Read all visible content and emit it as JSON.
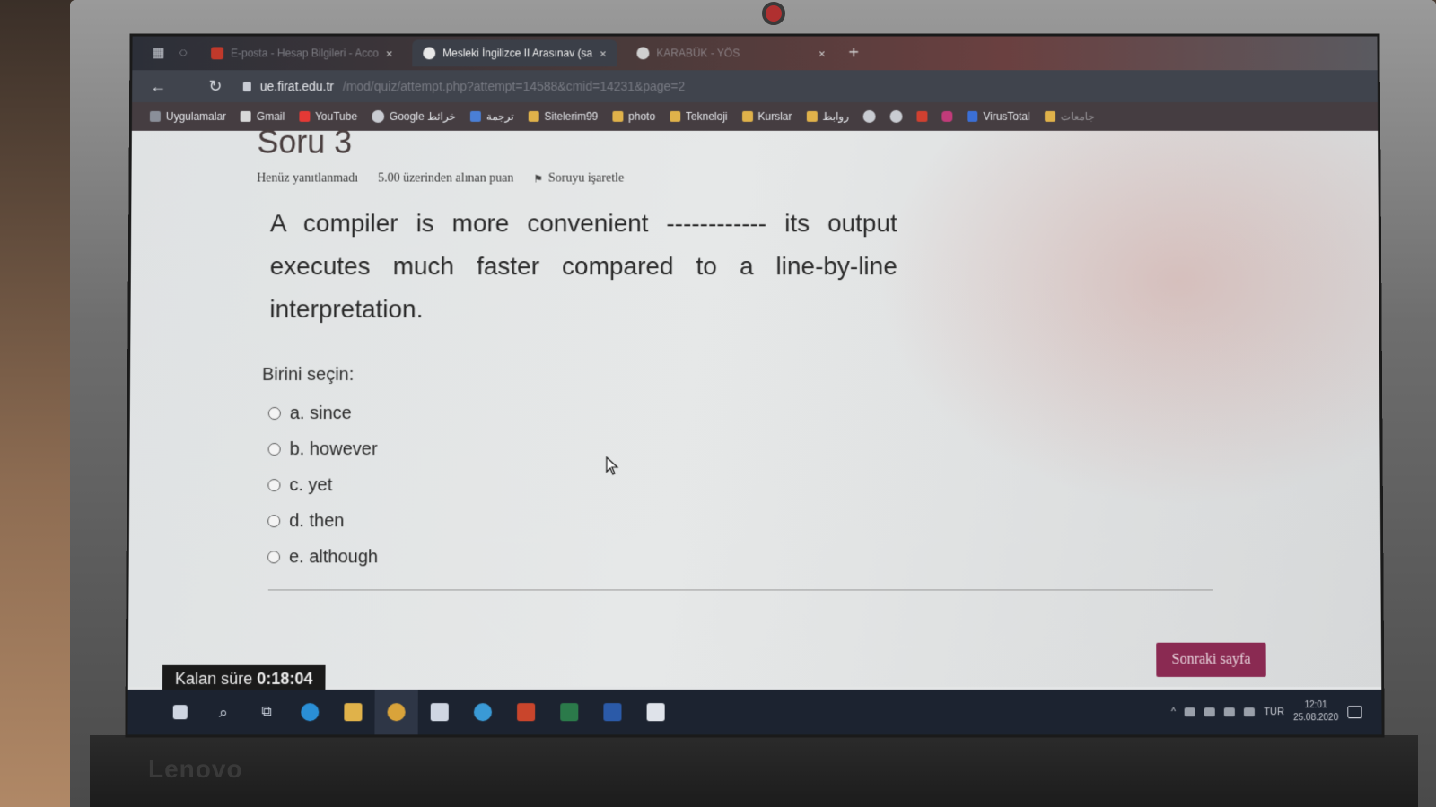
{
  "browser": {
    "tabs": [
      {
        "label": "E-posta - Hesap Bilgileri - Acco",
        "active": false
      },
      {
        "label": "Mesleki İngilizce II Arasınav (sa",
        "active": true
      },
      {
        "label": "KARABÜK - YÖS",
        "active": false
      }
    ],
    "url": "ue.firat.edu.tr",
    "url_rest": "/mod/quiz/attempt.php?attempt=14588&cmid=14231&page=2",
    "bookmarks": [
      "Uygulamalar",
      "Gmail",
      "YouTube",
      "Google خرائط",
      "ترجمة",
      "Sitelerim99",
      "photo",
      "Tekneloji",
      "Kurslar",
      "روابط",
      "VirusTotal",
      "جامعات"
    ]
  },
  "quiz": {
    "question_title": "Soru 3",
    "status": "Henüz yanıtlanmadı",
    "points": "5.00 üzerinden alınan puan",
    "flag_label": "Soruyu işaretle",
    "question_text": "A compiler is more convenient ------------ its output executes much faster compared to a line-by-line interpretation.",
    "prompt": "Birini seçin:",
    "answers": [
      {
        "label": "a. since"
      },
      {
        "label": "b. however"
      },
      {
        "label": "c. yet"
      },
      {
        "label": "d. then"
      },
      {
        "label": "e. although"
      }
    ],
    "next_button": "Sonraki sayfa",
    "timer_label": "Kalan süre",
    "timer_value": "0:18:04"
  },
  "taskbar": {
    "language": "TUR",
    "time": "12:01",
    "date": "25.08.2020"
  },
  "device": {
    "brand": "Lenovo"
  },
  "colors": {
    "next_button_bg": "#8a2a52",
    "timer_bg": "#1a1a1a",
    "taskbar_bg": "#1c2330"
  }
}
